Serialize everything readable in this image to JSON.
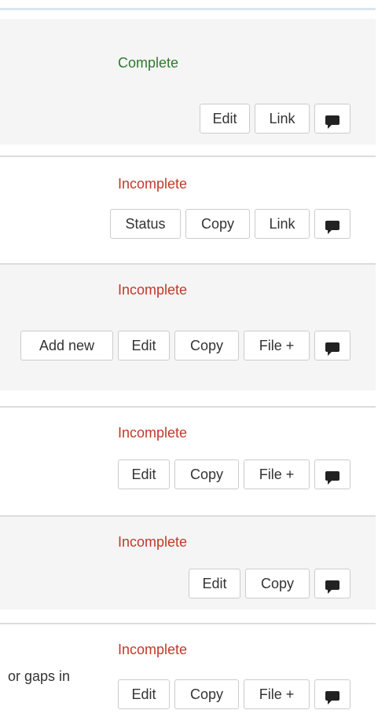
{
  "rows": [
    {
      "status": "Complete",
      "buttons": [
        "Edit",
        "Link"
      ]
    },
    {
      "status": "Incomplete",
      "buttons": [
        "Status",
        "Copy",
        "Link"
      ]
    },
    {
      "status": "Incomplete",
      "buttons": [
        "Add new",
        "Edit",
        "Copy",
        "File +"
      ]
    },
    {
      "status": "Incomplete",
      "buttons": [
        "Edit",
        "Copy",
        "File +"
      ]
    },
    {
      "status": "Incomplete",
      "buttons": [
        "Edit",
        "Copy"
      ]
    },
    {
      "status": "Incomplete",
      "description_fragment": "or gaps in",
      "buttons": [
        "Edit",
        "Copy",
        "File +"
      ]
    }
  ],
  "comment_icon": "comment-icon"
}
